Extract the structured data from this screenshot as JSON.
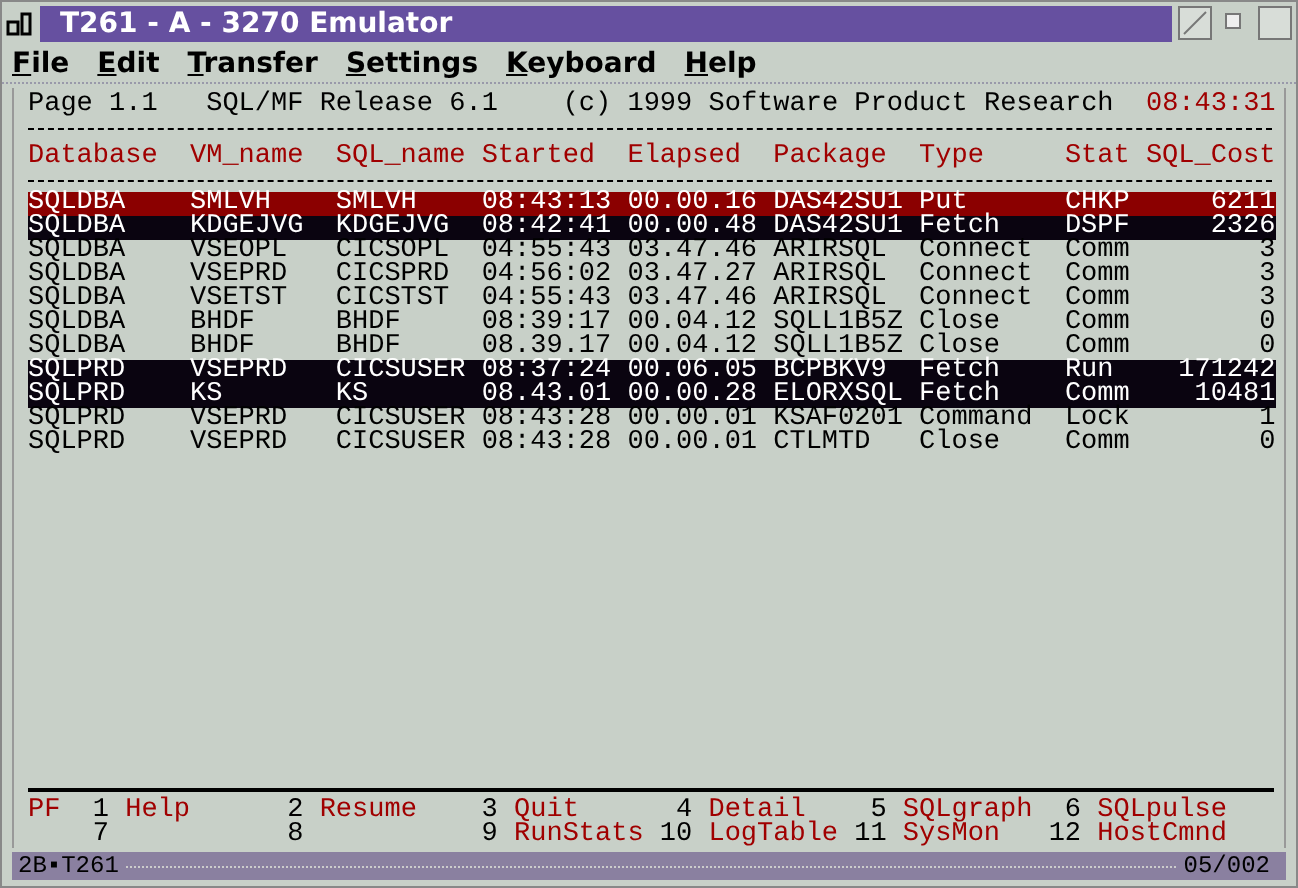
{
  "window": {
    "title": "T261 - A - 3270 Emulator"
  },
  "menu": [
    "File",
    "Edit",
    "Transfer",
    "Settings",
    "Keyboard",
    "Help"
  ],
  "screen_header": {
    "page": "Page 1.1",
    "release": "SQL/MF Release 6.1",
    "copyright": "(c) 1999 Software Product Research",
    "time": "08:43:31"
  },
  "table": {
    "columns": [
      "Database",
      "VM_name",
      "SQL_name",
      "Started",
      "Elapsed",
      "Package",
      "Type",
      "Stat",
      "SQL_Cost"
    ],
    "rows": [
      {
        "selected": true,
        "highlighted": false,
        "cells": [
          "SQLDBA",
          "SMLVH",
          "SMLVH",
          "08:43:13",
          "00.00.16",
          "DAS42SU1",
          "Put",
          "CHKP",
          "6211"
        ]
      },
      {
        "selected": false,
        "highlighted": true,
        "cells": [
          "SQLDBA",
          "KDGEJVG",
          "KDGEJVG",
          "08:42:41",
          "00.00.48",
          "DAS42SU1",
          "Fetch",
          "DSPF",
          "2326"
        ]
      },
      {
        "selected": false,
        "highlighted": false,
        "cells": [
          "SQLDBA",
          "VSEOPL",
          "CICSOPL",
          "04:55:43",
          "03.47.46",
          "ARIRSQL",
          "Connect",
          "Comm",
          "3"
        ]
      },
      {
        "selected": false,
        "highlighted": false,
        "cells": [
          "SQLDBA",
          "VSEPRD",
          "CICSPRD",
          "04:56:02",
          "03.47.27",
          "ARIRSQL",
          "Connect",
          "Comm",
          "3"
        ]
      },
      {
        "selected": false,
        "highlighted": false,
        "cells": [
          "SQLDBA",
          "VSETST",
          "CICSTST",
          "04:55:43",
          "03.47.46",
          "ARIRSQL",
          "Connect",
          "Comm",
          "3"
        ]
      },
      {
        "selected": false,
        "highlighted": false,
        "cells": [
          "SQLDBA",
          "BHDF",
          "BHDF",
          "08:39:17",
          "00.04.12",
          "SQLL1B5Z",
          "Close",
          "Comm",
          "0"
        ]
      },
      {
        "selected": false,
        "highlighted": false,
        "cells": [
          "SQLDBA",
          "BHDF",
          "BHDF",
          "08.39.17",
          "00.04.12",
          "SQLL1B5Z",
          "Close",
          "Comm",
          "0"
        ]
      },
      {
        "selected": false,
        "highlighted": true,
        "cells": [
          "SQLPRD",
          "VSEPRD",
          "CICSUSER",
          "08:37:24",
          "00.06.05",
          "BCPBKV9",
          "Fetch",
          "Run",
          "171242"
        ]
      },
      {
        "selected": false,
        "highlighted": true,
        "cells": [
          "SQLPRD",
          "KS",
          "KS",
          "08.43.01",
          "00.00.28",
          "ELORXSQL",
          "Fetch",
          "Comm",
          "10481"
        ]
      },
      {
        "selected": false,
        "highlighted": false,
        "cells": [
          "SQLPRD",
          "VSEPRD",
          "CICSUSER",
          "08:43:28",
          "00.00.01",
          "KSAF0201",
          "Command",
          "Lock",
          "1"
        ]
      },
      {
        "selected": false,
        "highlighted": false,
        "cells": [
          "SQLPRD",
          "VSEPRD",
          "CICSUSER",
          "08:43:28",
          "00.00.01",
          "CTLMTD",
          "Close",
          "Comm",
          "0"
        ]
      }
    ]
  },
  "pf_keys": {
    "label": "PF",
    "keys": [
      {
        "number": "1",
        "action": "Help"
      },
      {
        "number": "2",
        "action": "Resume"
      },
      {
        "number": "3",
        "action": "Quit"
      },
      {
        "number": "4",
        "action": "Detail"
      },
      {
        "number": "5",
        "action": "SQLgraph"
      },
      {
        "number": "6",
        "action": "SQLpulse"
      },
      {
        "number": "7"
      },
      {
        "number": "8"
      },
      {
        "number": "9",
        "action": "RunStats"
      },
      {
        "number": "10",
        "action": "LogTable"
      },
      {
        "number": "11",
        "action": "SysMon"
      },
      {
        "number": "12",
        "action": "HostCmnd"
      }
    ]
  },
  "status_bar": {
    "session": "2B▪T261",
    "position": "05/002"
  }
}
